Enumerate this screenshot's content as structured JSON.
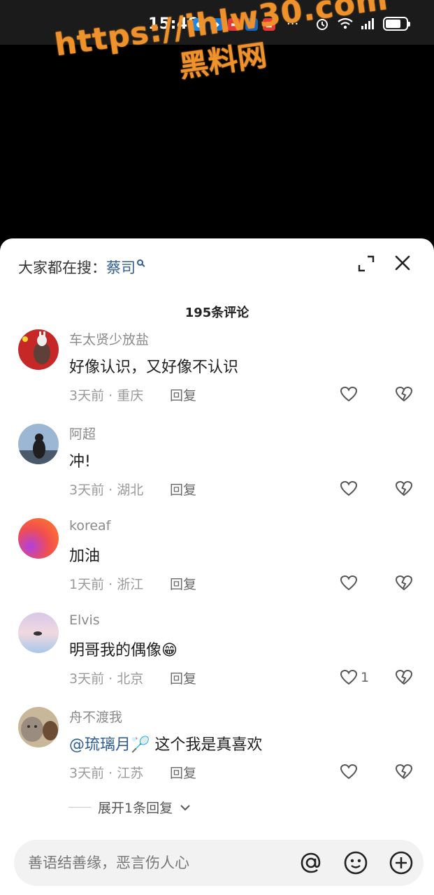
{
  "status_bar": {
    "time": "15:48",
    "more": "···",
    "battery_level": 0.75
  },
  "watermark": {
    "url": "https://ihlw30.com",
    "name": "黑料网"
  },
  "header": {
    "search_prefix": "大家都在搜：",
    "search_term": "蔡司",
    "comment_count": "195条评论"
  },
  "comments": [
    {
      "user": "车太贤少放盐",
      "text": "好像认识，又好像不认识",
      "meta": "3天前 · 重庆",
      "reply": "回复",
      "likes": ""
    },
    {
      "user": "阿超",
      "text": "冲!",
      "meta": "3天前 · 湖北",
      "reply": "回复",
      "likes": ""
    },
    {
      "user": "koreaf",
      "text": "加油",
      "meta": "1天前 · 浙江",
      "reply": "回复",
      "likes": ""
    },
    {
      "user": "Elvis",
      "text": "明哥我的偶像😁",
      "meta": "3天前 · 北京",
      "reply": "回复",
      "likes": "1"
    },
    {
      "user": "舟不渡我",
      "mention": "@琉璃月",
      "text": "🏸 这个我是真喜欢",
      "meta": "3天前 · 江苏",
      "reply": "回复",
      "likes": ""
    }
  ],
  "expand_replies": "展开1条回复",
  "input": {
    "placeholder": "善语结善缘，恶言伤人心"
  },
  "colors": {
    "link": "#2f5d93",
    "watermark": "#f0922c"
  }
}
